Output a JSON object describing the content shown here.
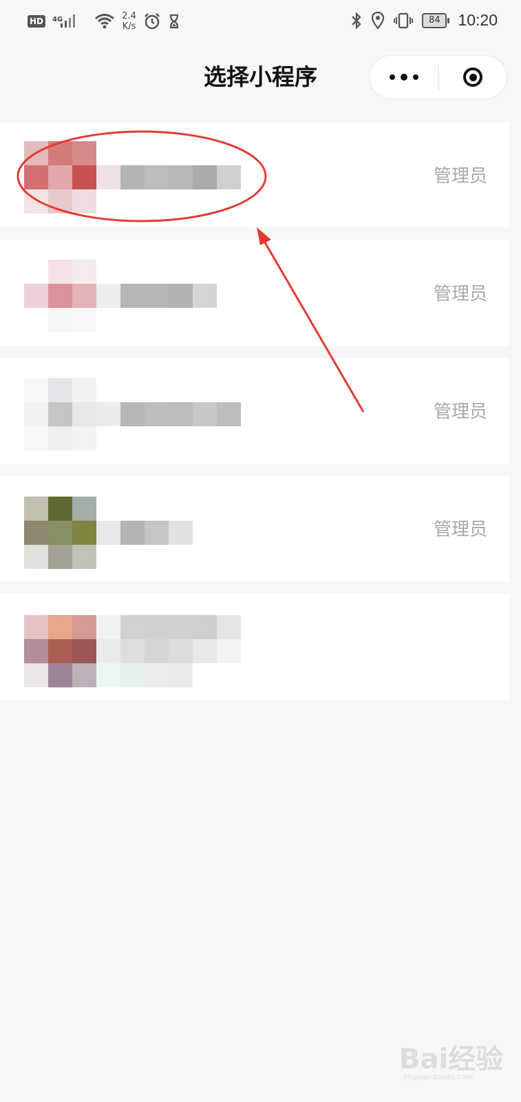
{
  "status_bar": {
    "hd": "HD",
    "network": "4G",
    "speed_value": "2.4",
    "speed_unit": "K/s",
    "battery": "84",
    "time": "10:20"
  },
  "header": {
    "title": "选择小程序"
  },
  "list": {
    "items": [
      {
        "role": "管理员"
      },
      {
        "role": "管理员"
      },
      {
        "role": "管理员"
      },
      {
        "role": "管理员"
      },
      {
        "role": ""
      }
    ]
  },
  "watermark": {
    "brand": "Bai经验",
    "url": "jingyan.baidu.com"
  },
  "colors": {
    "annotation_red": "#e23a32",
    "role_text": "#a9a9a9",
    "background": "#f7f7f7"
  }
}
